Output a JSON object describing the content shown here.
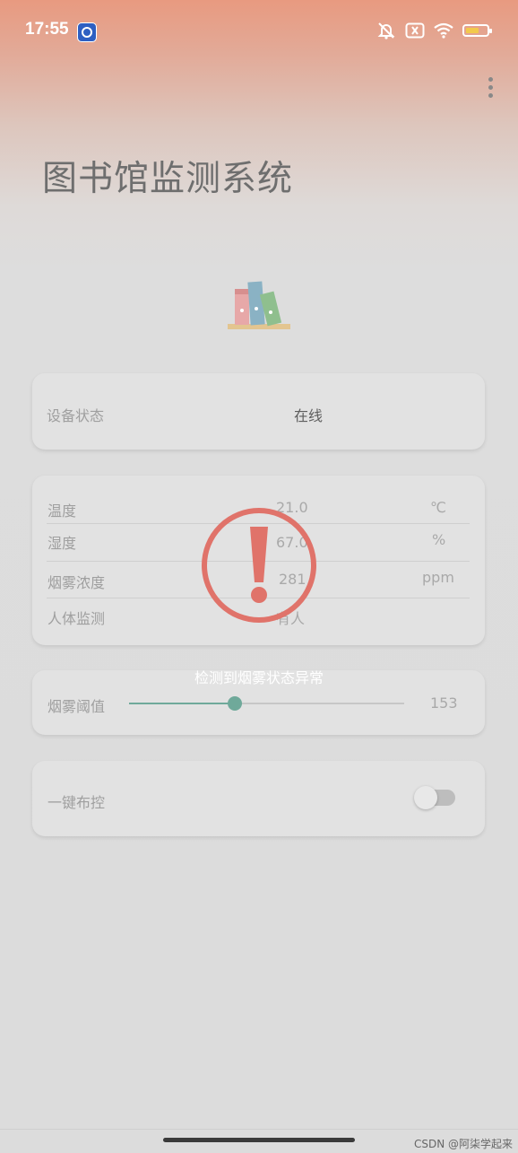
{
  "status_bar": {
    "time": "17:55",
    "icons": [
      "app-badge-icon",
      "mute-bell-icon",
      "sim-off-icon",
      "wifi-icon",
      "battery-icon"
    ],
    "battery_color": "#f2c94c"
  },
  "app": {
    "title": "图书馆监测系统",
    "menu_icon": "more-vert-icon",
    "logo_icon": "books-icon"
  },
  "device": {
    "label": "设备状态",
    "value": "在线"
  },
  "sensors": [
    {
      "label": "温度",
      "value": "21.0",
      "unit": "℃"
    },
    {
      "label": "湿度",
      "value": "67.0",
      "unit": "%"
    },
    {
      "label": "烟雾浓度",
      "value": "281",
      "unit": "ppm"
    },
    {
      "label": "人体监测",
      "value": "有人",
      "unit": ""
    }
  ],
  "threshold": {
    "label": "烟雾阈值",
    "value": "153",
    "slider_fraction": 0.385
  },
  "arm": {
    "label": "一键布控",
    "enabled": false
  },
  "alert": {
    "icon": "exclamation-alert-icon",
    "message": "检测到烟雾状态异常",
    "color": "#e0736a"
  },
  "watermark": "CSDN @阿柒学起来",
  "colors": {
    "accent": "#6fa99a",
    "header_gradient_top": "#e89a80"
  }
}
